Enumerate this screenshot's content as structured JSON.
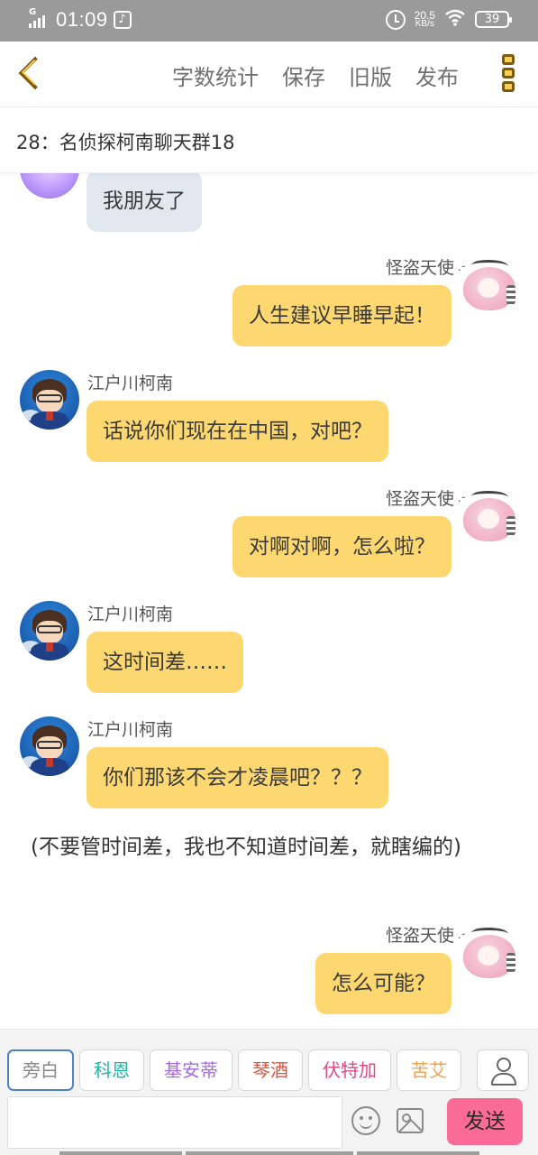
{
  "status_bar": {
    "signal_label": "G",
    "time": "01:09",
    "network_speed_value": "20.5",
    "network_speed_unit": "KB/s",
    "battery": "39",
    "icons": [
      "signal-icon",
      "music-icon",
      "alarm-icon",
      "wifi-icon",
      "battery-icon"
    ]
  },
  "toolbar": {
    "actions": [
      "字数统计",
      "保存",
      "旧版",
      "发布"
    ],
    "icons": [
      "back-chevron-icon",
      "more-menu-icon"
    ]
  },
  "chapter": {
    "title": "28：名侦探柯南聊天群18"
  },
  "chat": {
    "messages": [
      {
        "side": "left",
        "speaker": "",
        "text": "我朋友了",
        "bubble": "gray"
      },
      {
        "side": "right",
        "speaker": "怪盗天使",
        "text": "人生建议早睡早起！",
        "bubble": "yellow"
      },
      {
        "side": "left",
        "speaker": "江户川柯南",
        "text": "话说你们现在在中国，对吧？",
        "bubble": "yellow"
      },
      {
        "side": "right",
        "speaker": "怪盗天使",
        "text": "对啊对啊，怎么啦？",
        "bubble": "yellow"
      },
      {
        "side": "left",
        "speaker": "江户川柯南",
        "text": "这时间差……",
        "bubble": "yellow"
      },
      {
        "side": "left",
        "speaker": "江户川柯南",
        "text": "你们那该不会才凌晨吧？？？",
        "bubble": "yellow"
      },
      {
        "side": "narration",
        "speaker": "",
        "text": "(不要管时间差，我也不知道时间差，就瞎编的)"
      },
      {
        "side": "right",
        "speaker": "怪盗天使",
        "text": "怎么可能？",
        "bubble": "yellow"
      }
    ]
  },
  "composer": {
    "roles": [
      {
        "label": "旁白",
        "color": "#888888",
        "selected": true
      },
      {
        "label": "科恩",
        "color": "#1fb3a9",
        "selected": false
      },
      {
        "label": "基安蒂",
        "color": "#a66be0",
        "selected": false
      },
      {
        "label": "琴酒",
        "color": "#e0533d",
        "selected": false
      },
      {
        "label": "伏特加",
        "color": "#e04a87",
        "selected": false
      },
      {
        "label": "苦艾",
        "color": "#f0a14d",
        "selected": false
      }
    ],
    "input_value": "",
    "input_placeholder": "",
    "send_label": "发送",
    "send_color": "#fa6b98",
    "icons": [
      "user-icon",
      "emoji-icon",
      "image-icon"
    ]
  },
  "colors": {
    "bubble_yellow": "#fdd870",
    "bubble_gray": "#e2e8f0",
    "accent_brown": "#7b5a10"
  }
}
